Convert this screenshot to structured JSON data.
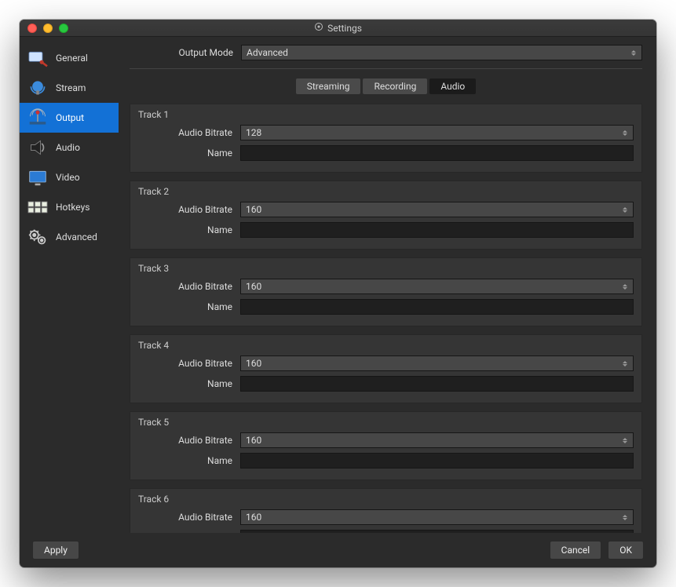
{
  "title": "Settings",
  "sidebar": {
    "items": [
      {
        "id": "general",
        "label": "General"
      },
      {
        "id": "stream",
        "label": "Stream"
      },
      {
        "id": "output",
        "label": "Output"
      },
      {
        "id": "audio",
        "label": "Audio"
      },
      {
        "id": "video",
        "label": "Video"
      },
      {
        "id": "hotkeys",
        "label": "Hotkeys"
      },
      {
        "id": "advanced",
        "label": "Advanced"
      }
    ],
    "active": "output"
  },
  "output_mode": {
    "label": "Output Mode",
    "value": "Advanced"
  },
  "tabs": {
    "items": [
      {
        "id": "streaming",
        "label": "Streaming"
      },
      {
        "id": "recording",
        "label": "Recording"
      },
      {
        "id": "audio",
        "label": "Audio"
      }
    ],
    "active": "audio"
  },
  "field_labels": {
    "bitrate": "Audio Bitrate",
    "name": "Name"
  },
  "tracks": [
    {
      "title": "Track 1",
      "bitrate": "128",
      "name": ""
    },
    {
      "title": "Track 2",
      "bitrate": "160",
      "name": ""
    },
    {
      "title": "Track 3",
      "bitrate": "160",
      "name": ""
    },
    {
      "title": "Track 4",
      "bitrate": "160",
      "name": ""
    },
    {
      "title": "Track 5",
      "bitrate": "160",
      "name": ""
    },
    {
      "title": "Track 6",
      "bitrate": "160",
      "name": ""
    }
  ],
  "buttons": {
    "apply": "Apply",
    "cancel": "Cancel",
    "ok": "OK"
  }
}
